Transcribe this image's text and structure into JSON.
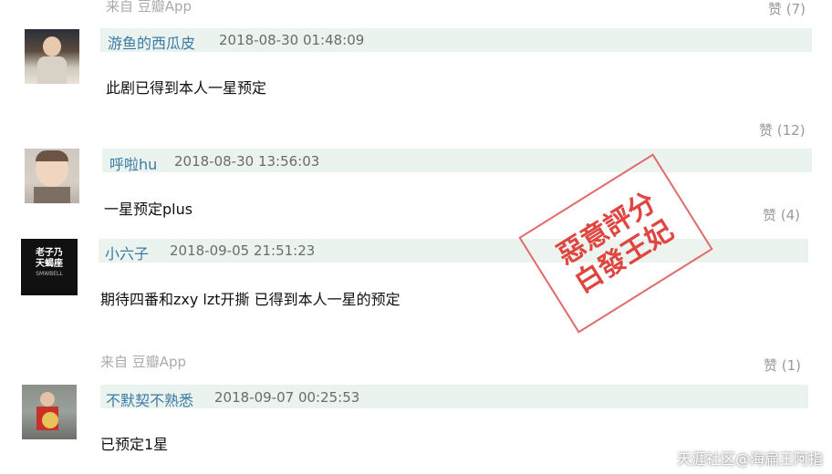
{
  "comments": [
    {
      "from": "来自 豆瓣App",
      "likes": "赞 (7)",
      "username": "游鱼的西瓜皮",
      "time": "2018-08-30 01:48:09",
      "text": "此剧已得到本人一星预定"
    },
    {
      "likes": "赞 (12)",
      "username": "呼啦hu",
      "time": "2018-08-30 13:56:03",
      "text": "一星预定plus"
    },
    {
      "likes": "赞 (4)",
      "username": "小六子",
      "time": "2018-09-05 21:51:23",
      "text": "期待四番和zxy lzt开撕 已得到本人一星的预定",
      "avatar_text": [
        "老子乃",
        "天蝎座",
        "SMWBELL"
      ]
    },
    {
      "from": "来自 豆瓣App",
      "likes": "赞 (1)",
      "username": "不默契不熟悉",
      "time": "2018-09-07 00:25:53",
      "text": "已预定1星"
    }
  ],
  "stamp": {
    "line1": "惡意評分",
    "line2": "白發王妃",
    "color": "#e0453f"
  },
  "watermark": "天涯社区@海扁王阿指",
  "colors": {
    "name": "#3c7aa6",
    "bar": "#eaf3ee"
  }
}
